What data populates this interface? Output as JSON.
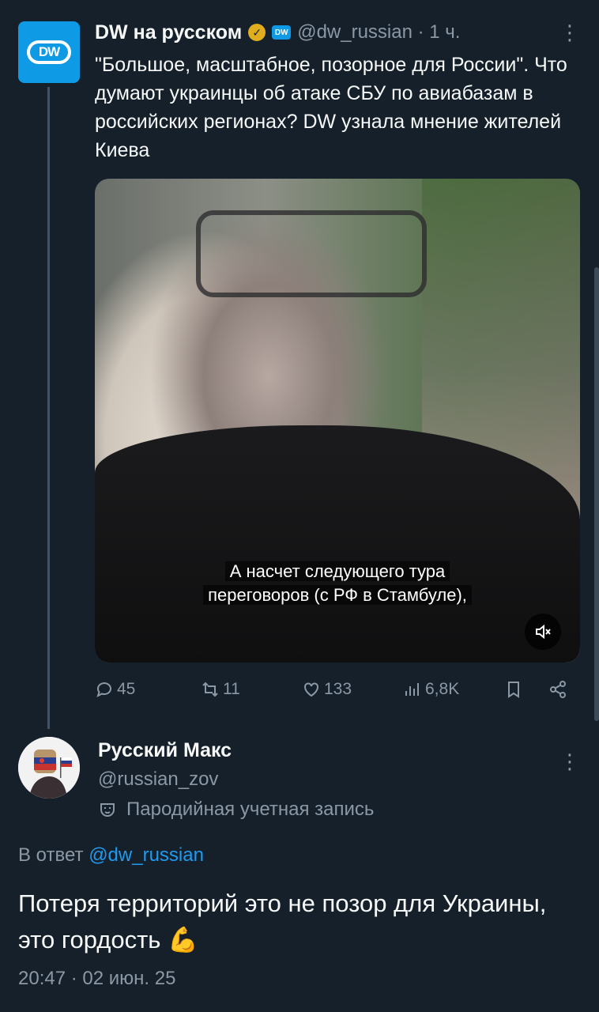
{
  "parent_tweet": {
    "display_name": "DW на русском",
    "handle_time": "@dw_russian · 1 ч.",
    "avatar_text": "DW",
    "affiliate_badge": "DW",
    "text": "\"Большое, масштабное, позорное для России\". Что думают украинцы об атаке СБУ по авиабазам в российских регионах? DW узнала мнение жителей Киева",
    "media": {
      "caption_line1": "А насчет следующего тура",
      "caption_line2": "переговоров (с РФ в Стамбуле),",
      "mute_icon": "mute-icon"
    },
    "metrics": {
      "replies": "45",
      "retweets": "11",
      "likes": "133",
      "views": "6,8K"
    }
  },
  "reply_tweet": {
    "display_name": "Русский Макс",
    "handle": "@russian_zov",
    "parody_label": "Пародийная учетная запись",
    "reply_prefix": "В ответ",
    "reply_to_handle": "@dw_russian",
    "text": "Потеря территорий это не позор для Украины, это гордость 💪",
    "timestamp": "20:47 · 02 июн. 25"
  },
  "colors": {
    "background": "#15202b",
    "text_primary": "#f7f9f9",
    "text_secondary": "#8b98a5",
    "accent": "#1d9bf0",
    "dw_blue": "#0e9ae5",
    "verified_gold": "#e0ad1e"
  }
}
